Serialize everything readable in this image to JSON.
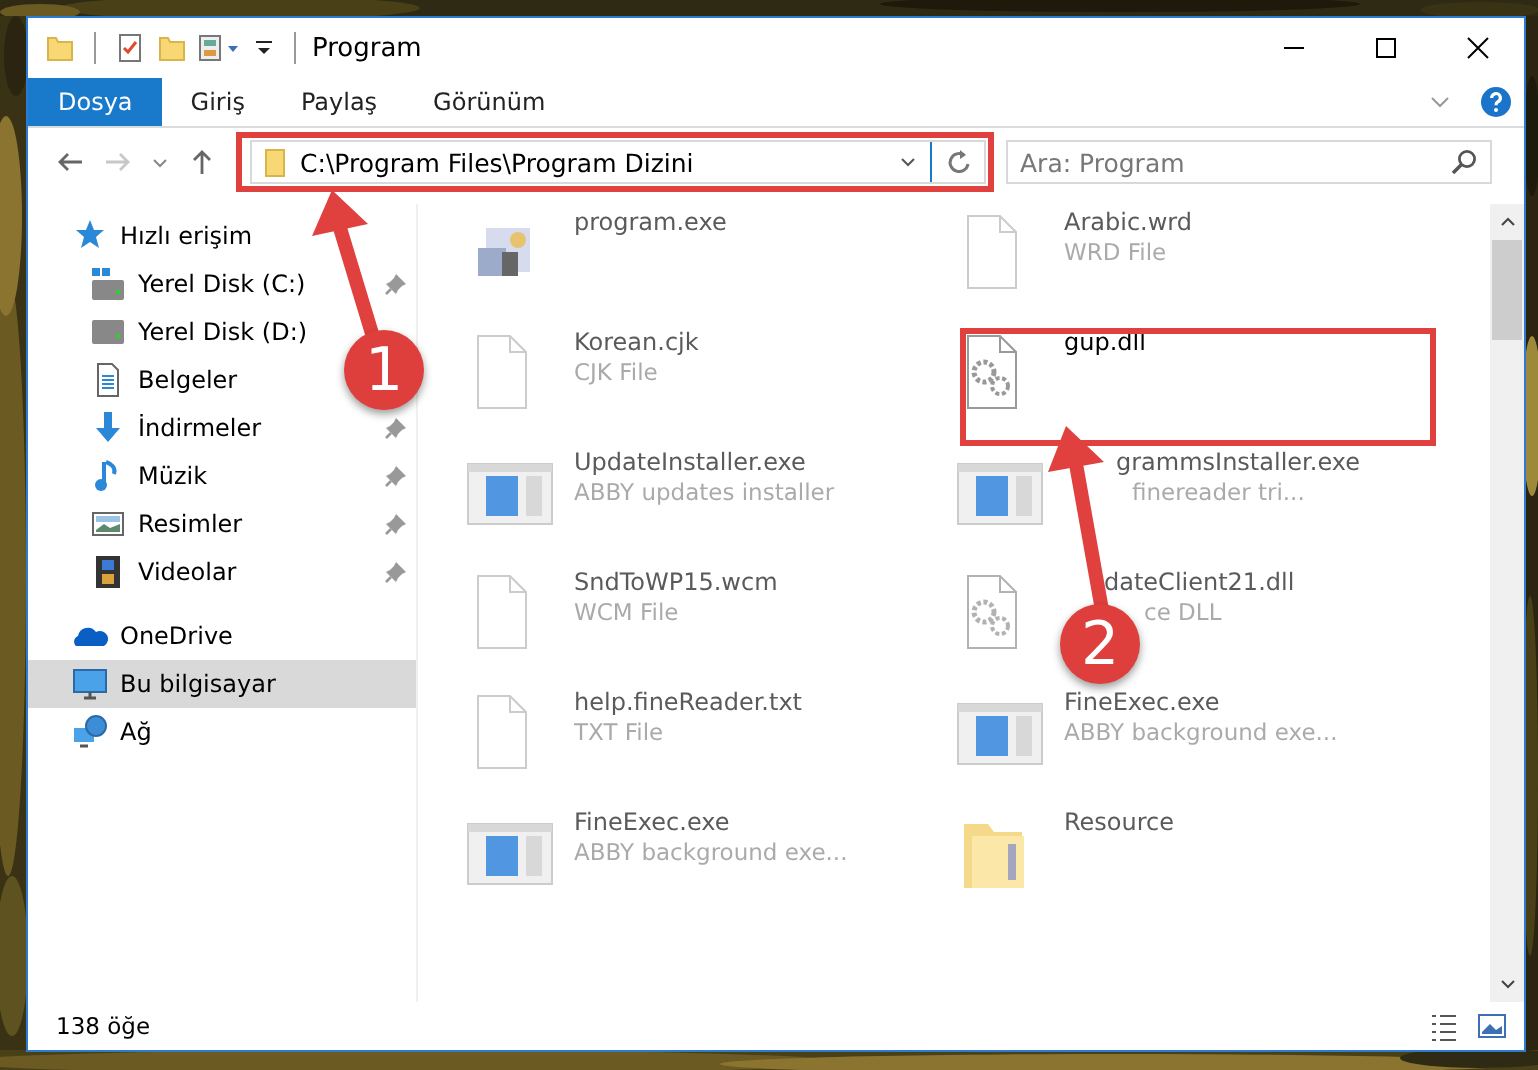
{
  "window": {
    "title": "Program"
  },
  "ribbon_tabs": [
    {
      "label": "Dosya",
      "selected": true
    },
    {
      "label": "Giriş",
      "selected": false
    },
    {
      "label": "Paylaş",
      "selected": false
    },
    {
      "label": "Görünüm",
      "selected": false
    }
  ],
  "address": {
    "path": "C:\\Program Files\\Program Dizini"
  },
  "search": {
    "placeholder": "Ara: Program"
  },
  "sidebar": {
    "items": [
      {
        "label": "Hızlı erişim",
        "kind": "star",
        "selected": false,
        "children": [
          {
            "label": "Yerel Disk (C:)",
            "kind": "drive-c",
            "pinned": true,
            "selected": false
          },
          {
            "label": "Yerel Disk (D:)",
            "kind": "drive",
            "pinned": false,
            "selected": false
          },
          {
            "label": "Belgeler",
            "kind": "documents",
            "pinned": false,
            "selected": false
          },
          {
            "label": "İndirmeler",
            "kind": "download",
            "pinned": true,
            "selected": false
          },
          {
            "label": "Müzik",
            "kind": "music",
            "pinned": true,
            "selected": false
          },
          {
            "label": "Resimler",
            "kind": "pictures",
            "pinned": true,
            "selected": false
          },
          {
            "label": "Videolar",
            "kind": "videos",
            "pinned": true,
            "selected": false
          }
        ]
      },
      {
        "label": "OneDrive",
        "kind": "cloud",
        "selected": false
      },
      {
        "label": "Bu bilgisayar",
        "kind": "computer",
        "selected": true
      },
      {
        "label": "Ağ",
        "kind": "network",
        "selected": false
      }
    ]
  },
  "files": [
    {
      "name": "program.exe",
      "kind": "app",
      "blurred": true
    },
    {
      "name": "Arabic.wrd",
      "detail": "WRD File",
      "kind": "blank",
      "blurred": true
    },
    {
      "name": "Korean.cjk",
      "detail": "CJK File",
      "kind": "blank",
      "blurred": true
    },
    {
      "name": "gup.dll",
      "kind": "gear",
      "blurred": false
    },
    {
      "name": "UpdateInstaller.exe",
      "detail": "ABBY updates installer",
      "kind": "window",
      "blurred": true
    },
    {
      "name": "grammsInstaller.exe",
      "detail": "finereader tri...",
      "kind": "window",
      "blurred": true
    },
    {
      "name": "SndToWP15.wcm",
      "detail": "WCM File",
      "kind": "blank",
      "blurred": true
    },
    {
      "name": "dateClient21.dll",
      "detail": "ce DLL",
      "kind": "gear",
      "blurred": true
    },
    {
      "name": "help.fineReader.txt",
      "detail": "TXT File",
      "kind": "blank",
      "blurred": true
    },
    {
      "name": "FineExec.exe",
      "detail": "ABBY background exe...",
      "kind": "window",
      "blurred": true
    },
    {
      "name": "FineExec.exe",
      "detail": "ABBY background exe...",
      "kind": "window",
      "blurred": true
    },
    {
      "name": "Resource",
      "kind": "folder",
      "blurred": true
    }
  ],
  "status_bar": {
    "count": "138 öğe"
  },
  "annotations": [
    {
      "number": "1"
    },
    {
      "number": "2"
    }
  ]
}
